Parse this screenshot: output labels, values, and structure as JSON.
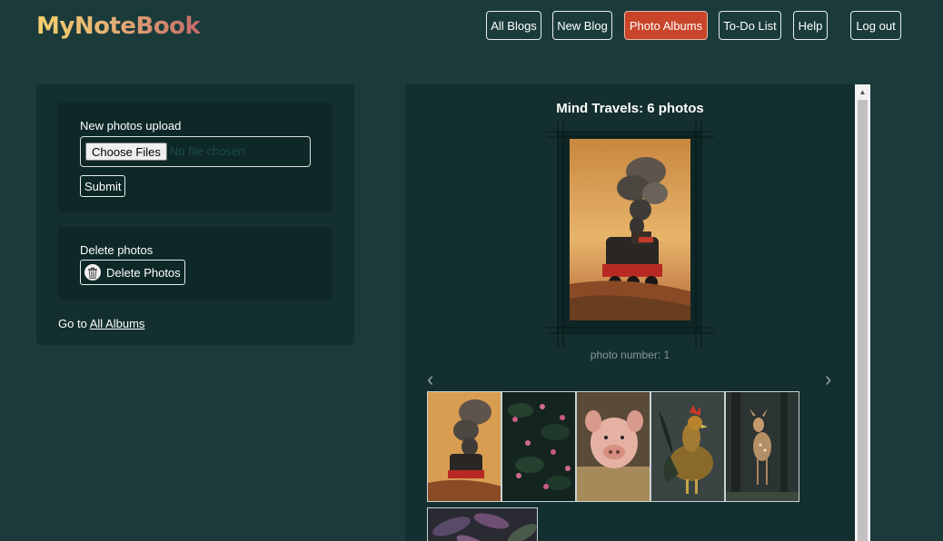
{
  "header": {
    "logo": "MyNoteBook",
    "nav": [
      {
        "label": "All Blogs"
      },
      {
        "label": "New Blog"
      },
      {
        "label": "Photo Albums"
      },
      {
        "label": "To-Do List"
      },
      {
        "label": "Help"
      },
      {
        "label": "Log out"
      }
    ],
    "active_nav": "Photo Albums"
  },
  "upload": {
    "title": "New photos upload",
    "choose_files": "Choose Files",
    "no_file": "No file chosen",
    "submit": "Submit"
  },
  "delete": {
    "title": "Delete photos",
    "button": "Delete Photos",
    "icon": "trash-icon"
  },
  "goto": {
    "prefix": "Go to",
    "link": "All Albums"
  },
  "album": {
    "title": "Mind Travels: 6 photos",
    "caption": "photo number: 1",
    "prev_icon": "‹",
    "next_icon": "›",
    "thumbnails": [
      {
        "subject": "steam-train"
      },
      {
        "subject": "pink-flowers"
      },
      {
        "subject": "piglet"
      },
      {
        "subject": "rooster"
      },
      {
        "subject": "fawn"
      },
      {
        "subject": "leaves"
      }
    ]
  },
  "colors": {
    "background": "#1b3b3b",
    "panel": "#142f2f",
    "card": "#0e2828",
    "active_nav": "#c8452a"
  }
}
